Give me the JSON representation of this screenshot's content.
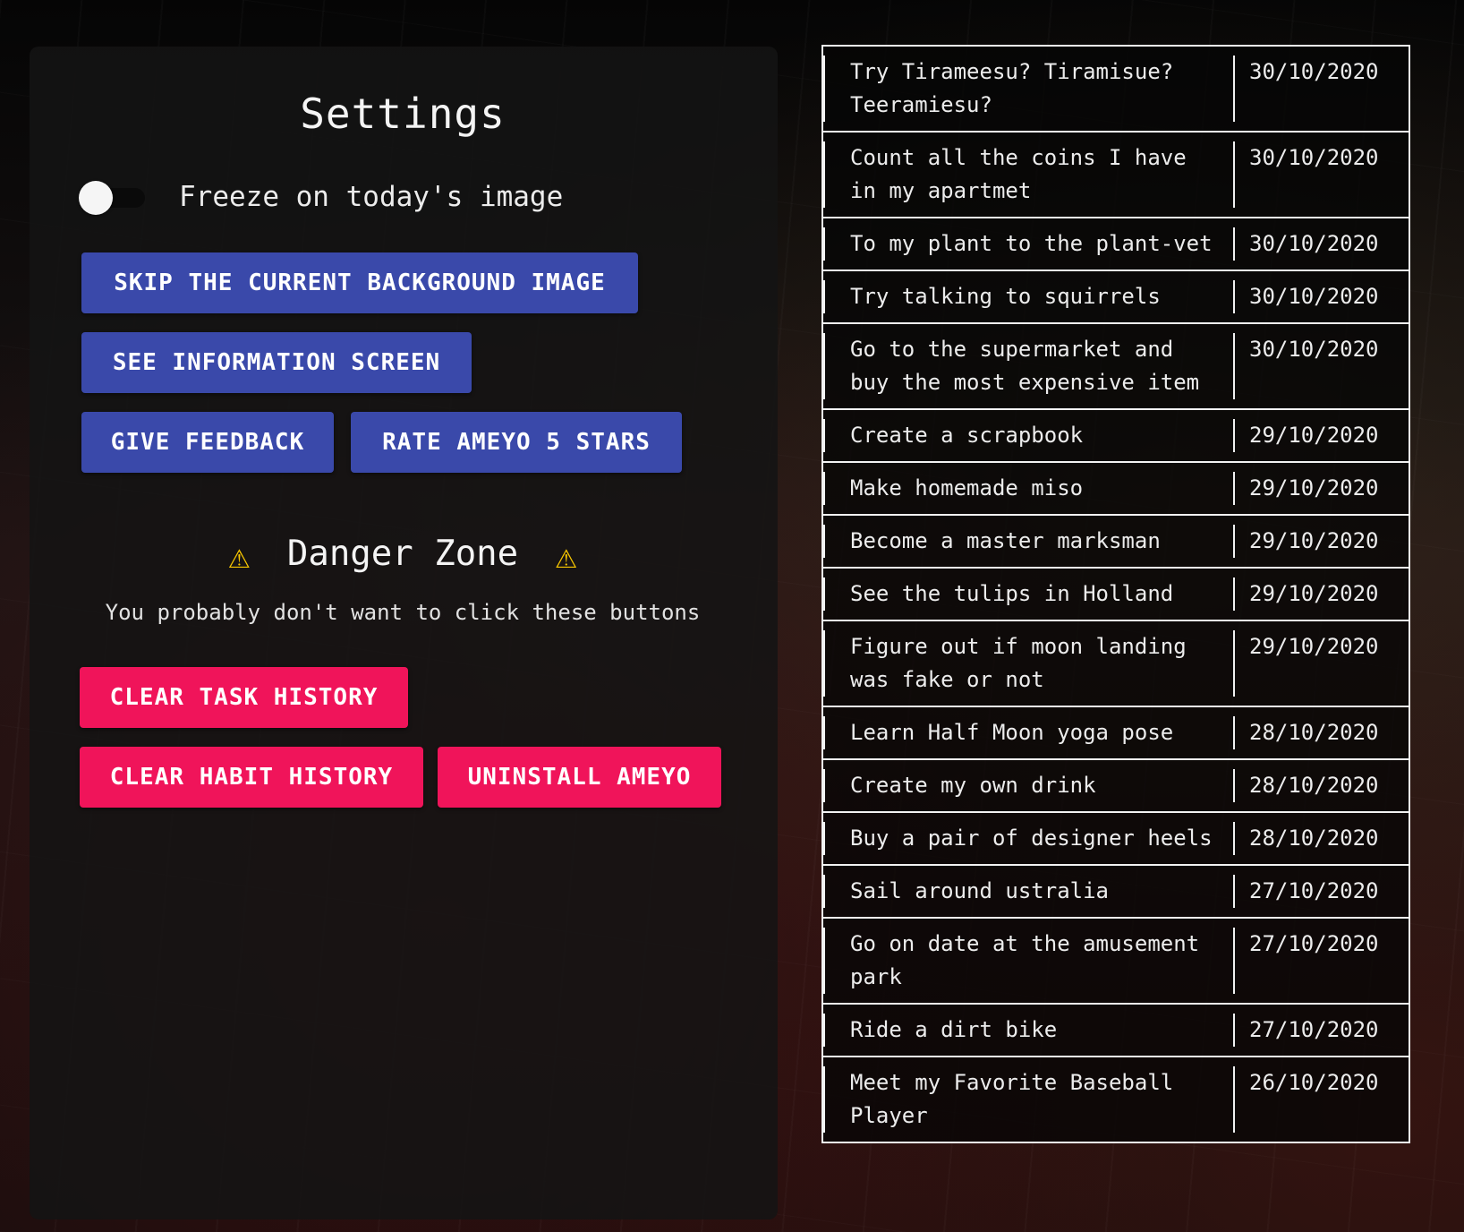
{
  "settings": {
    "title": "Settings",
    "freeze_label": "Freeze on today's image",
    "freeze_enabled": false,
    "buttons": {
      "skip_background": "SKIP THE CURRENT BACKGROUND IMAGE",
      "see_information": "SEE INFORMATION SCREEN",
      "give_feedback": "GIVE FEEDBACK",
      "rate": "RATE AMEYO 5 STARS"
    }
  },
  "danger_zone": {
    "title": "Danger Zone",
    "warning_icon": "⚠",
    "subtitle": "You probably don't want to click these buttons",
    "buttons": {
      "clear_task_history": "CLEAR TASK HISTORY",
      "clear_habit_history": "CLEAR HABIT HISTORY",
      "uninstall": "UNINSTALL AMEYO"
    }
  },
  "colors": {
    "primary_button": "#3a49aa",
    "danger_button": "#f0145a",
    "warning_icon": "#f7c600"
  },
  "task_history": [
    {
      "task": "Try Tirameesu? Tiramisue? Teeramiesu?",
      "date": "30/10/2020"
    },
    {
      "task": "Count all the coins I have in my apartmet",
      "date": "30/10/2020"
    },
    {
      "task": "To my plant to the plant-vet",
      "date": "30/10/2020"
    },
    {
      "task": "Try talking to squirrels",
      "date": "30/10/2020"
    },
    {
      "task": "Go to the supermarket and buy the most expensive item",
      "date": "30/10/2020"
    },
    {
      "task": "Create a scrapbook",
      "date": "29/10/2020"
    },
    {
      "task": "Make homemade miso",
      "date": "29/10/2020"
    },
    {
      "task": "Become a master marksman",
      "date": "29/10/2020"
    },
    {
      "task": "See the tulips in Holland",
      "date": "29/10/2020"
    },
    {
      "task": "Figure out if moon landing was fake or not",
      "date": "29/10/2020"
    },
    {
      "task": "Learn Half Moon yoga pose",
      "date": "28/10/2020"
    },
    {
      "task": "Create my own drink",
      "date": "28/10/2020"
    },
    {
      "task": "Buy a pair of designer heels",
      "date": "28/10/2020"
    },
    {
      "task": "Sail around ustralia",
      "date": "27/10/2020"
    },
    {
      "task": "Go on date at the amusement park",
      "date": "27/10/2020"
    },
    {
      "task": "Ride a dirt bike",
      "date": "27/10/2020"
    },
    {
      "task": "Meet my Favorite Baseball Player",
      "date": "26/10/2020"
    }
  ]
}
